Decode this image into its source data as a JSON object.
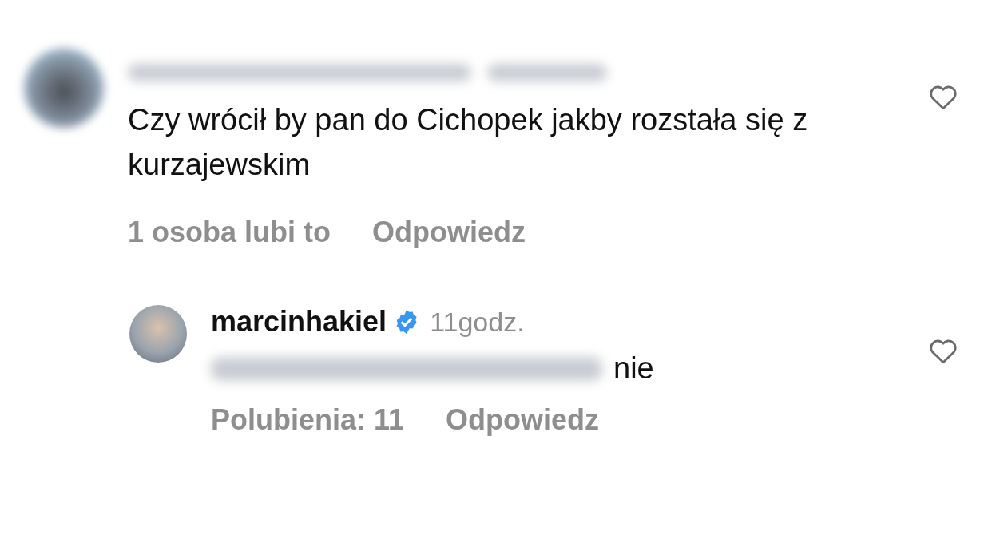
{
  "comments": [
    {
      "text": "Czy wrócił by pan do Cichopek jakby rozstała się z kurzajewskim",
      "likes": "1 osoba lubi to",
      "reply": "Odpowiedz",
      "liked": false
    },
    {
      "username": "marcinhakiel",
      "verified": true,
      "time": "11godz.",
      "text": "nie",
      "likes": "Polubienia: 11",
      "reply": "Odpowiedz",
      "liked": false
    }
  ]
}
